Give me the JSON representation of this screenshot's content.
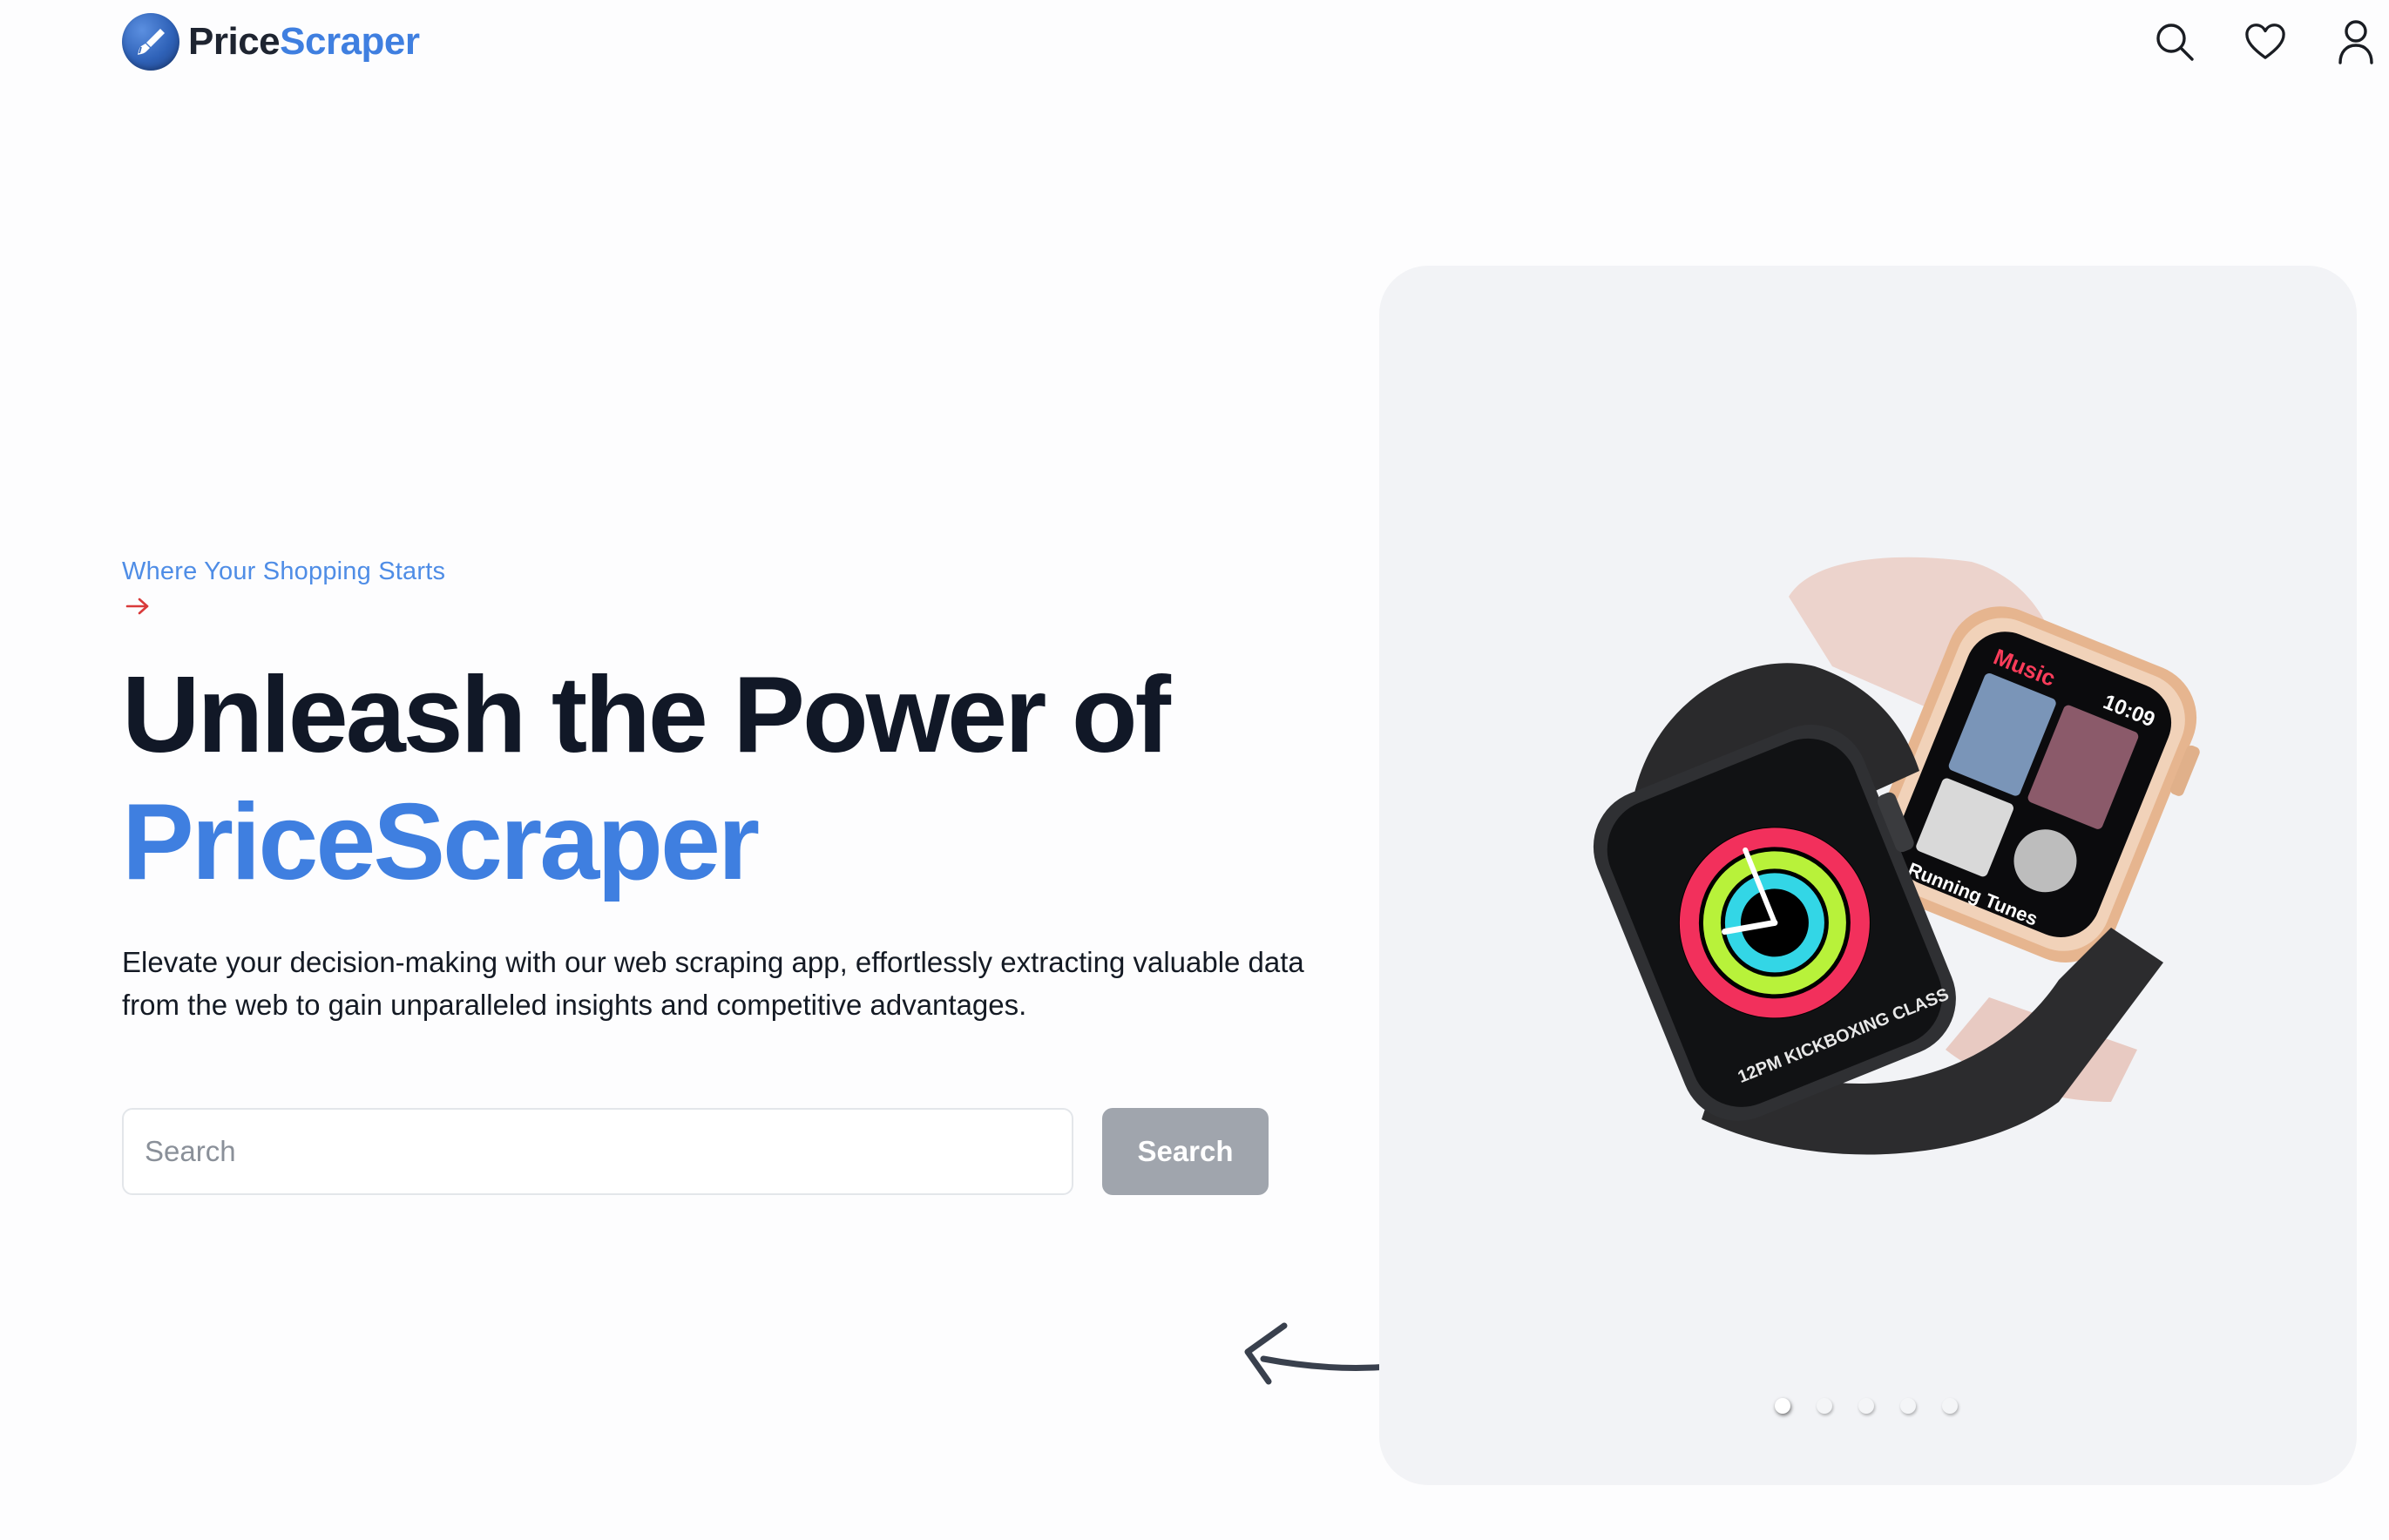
{
  "header": {
    "brand_part1": "Price",
    "brand_part2": "Scraper",
    "icons": [
      "search-icon",
      "heart-icon",
      "user-icon"
    ]
  },
  "hero": {
    "tagline": "Where Your Shopping Starts",
    "headline_line1": "Unleash the Power of",
    "headline_line2": "PriceScraper",
    "description": "Elevate your decision-making with our web scraping app, effortlessly extracting valuable data from the web to gain unparalleled insights and competitive advantages.",
    "search": {
      "placeholder": "Search",
      "button_label": "Search"
    }
  },
  "carousel": {
    "slide_count": 5,
    "active_index": 0,
    "watch_screen": {
      "title": "Music",
      "time": "10:09",
      "caption": "Running Tunes"
    },
    "watch_screen2": {
      "caption": "12PM KICKBOXING CLASS"
    }
  },
  "colors": {
    "accent": "#3f7fe0",
    "heading": "#111827",
    "tagline_arrow": "#d93a3a",
    "card_bg": "#f2f3f6",
    "button_bg": "#a0a5ad"
  }
}
